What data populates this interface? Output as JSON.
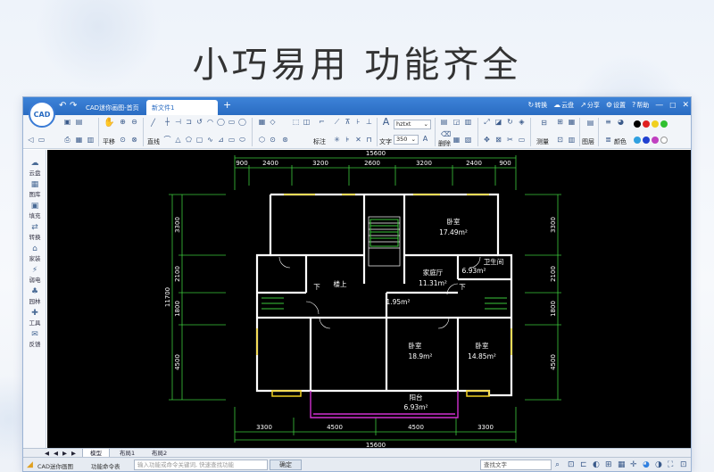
{
  "hero": {
    "title": "小巧易用  功能齐全"
  },
  "app": {
    "logo_text": "CAD",
    "tabs": [
      {
        "label": "CAD迷你画图-首页"
      },
      {
        "label": "新文件1"
      }
    ],
    "tab_add": "+",
    "title_actions": [
      {
        "icon": "↻",
        "label": "转换"
      },
      {
        "icon": "☁",
        "label": "云盘"
      },
      {
        "icon": "↗",
        "label": "分享"
      },
      {
        "icon": "⚙",
        "label": "设置"
      },
      {
        "icon": "?",
        "label": "帮助"
      }
    ],
    "toolbar": {
      "pan_label": "平移",
      "line_label": "直线",
      "dim_label": "标注",
      "text_label": "文字",
      "font_value": "hztxt",
      "size_value": "350",
      "delete_label": "删除",
      "measure_label": "测量",
      "layer_label": "图层",
      "color_label": "颜色"
    },
    "swatches": [
      "#000000",
      "#e02020",
      "#f0d020",
      "#30c030",
      "#30a0e0",
      "#2040d0",
      "#c040c0",
      "#ffffff"
    ],
    "sidebar": [
      {
        "icon": "☁",
        "label": "云盘"
      },
      {
        "icon": "▦",
        "label": "图库"
      },
      {
        "icon": "▣",
        "label": "填充"
      },
      {
        "icon": "⇄",
        "label": "转换"
      },
      {
        "icon": "⌂",
        "label": "家装"
      },
      {
        "icon": "⚡",
        "label": "弱电"
      },
      {
        "icon": "♣",
        "label": "园林"
      },
      {
        "icon": "✚",
        "label": "工具"
      },
      {
        "icon": "✉",
        "label": "反馈"
      }
    ],
    "drawing": {
      "top_total": "15600",
      "top_dims": [
        "900",
        "2400",
        "3200",
        "2600",
        "3200",
        "2400",
        "900"
      ],
      "bottom_dims": [
        "3300",
        "4500",
        "4500",
        "3300"
      ],
      "bottom_total": "15600",
      "left_total": "11700",
      "left_dims": [
        "3300",
        "2100",
        "1800",
        "4500"
      ],
      "right_dims": [
        "3300",
        "2100",
        "1800",
        "4500"
      ],
      "rooms": [
        {
          "name": "卧室",
          "area": "17.49m²"
        },
        {
          "name": "卫生间",
          "area": "6.93m²"
        },
        {
          "name": "家庭厅",
          "area": "11.31m²"
        },
        {
          "name": "楼上",
          "area": ""
        },
        {
          "name": "",
          "area": "1.95m²"
        },
        {
          "name": "卧室",
          "area": "18.9m²"
        },
        {
          "name": "卧室",
          "area": "14.85m²"
        },
        {
          "name": "阳台",
          "area": "6.93m²"
        }
      ],
      "stair_marks": [
        "下",
        "下"
      ]
    },
    "sheet_tabs": [
      {
        "label": "模型"
      },
      {
        "label": "布局1"
      },
      {
        "label": "布局2"
      }
    ],
    "status": {
      "app_name": "CAD迷你画图",
      "cmd_label": "功能命令表",
      "cmd_placeholder": "输入功能或命令关键词, 快速查找功能",
      "ok_label": "确定",
      "find_label": "查找文字"
    }
  }
}
